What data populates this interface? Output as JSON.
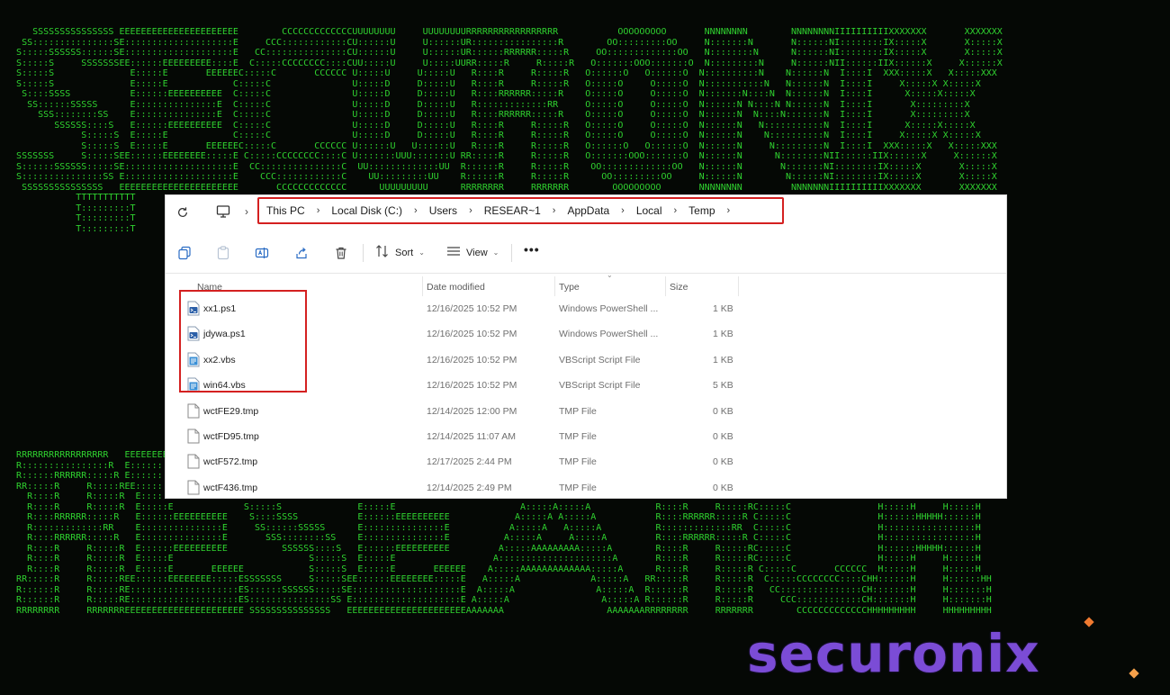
{
  "background": {
    "top_ascii": [
      "      SSSSSSSSSSSSSSS EEEEEEEEEEEEEEEEEEEEEE        CCCCCCCCCCCCCUUUUUUUU     UUUUUUUURRRRRRRRRRRRRRRRR           OOOOOOOOO       NNNNNNNN        NNNNNNNNIIIIIIIIIIXXXXXXX       XXXXXXX",
      "    SS:::::::::::::::SE::::::::::::::::::::E     CCC::::::::::::CU::::::U     U::::::UR::::::::::::::::R        OO:::::::::OO     N:::::::N       N::::::NI::::::::IX:::::X       X:::::X",
      "   S:::::SSSSSS::::::SE::::::::::::::::::::E   CC:::::::::::::::CU::::::U     U::::::UR::::::RRRRRR:::::R     OO:::::::::::::OO   N::::::::N      N::::::NI::::::::IX:::::X       X:::::X",
      "   S:::::S     SSSSSSSEE::::::EEEEEEEEE::::E  C:::::CCCCCCCC::::CUU:::::U     U:::::UURR:::::R     R:::::R   O:::::::OOO:::::::O  N:::::::::N     N::::::NII::::::IIX::::::X     X::::::X",
      "   S:::::S              E:::::E       EEEEEEC:::::C       CCCCCC U:::::U     U:::::U   R::::R     R:::::R   O::::::O   O::::::O  N::::::::::N    N::::::N  I::::I  XXX:::::X   X:::::XXX",
      "   S:::::S              E:::::E            C:::::C               U:::::D     D:::::U   R::::R     R:::::R   O:::::O     O:::::O  N:::::::::::N   N::::::N  I::::I     X:::::X X:::::X",
      "    S::::SSSS           E::::::EEEEEEEEEE  C:::::C               U:::::D     D:::::U   R::::RRRRRR:::::R    O:::::O     O:::::O  N:::::::N::::N  N::::::N  I::::I      X:::::X:::::X",
      "     SS::::::SSSSS      E:::::::::::::::E  C:::::C               U:::::D     D:::::U   R:::::::::::::RR     O:::::O     O:::::O  N::::::N N::::N N::::::N  I::::I       X:::::::::X",
      "       SSS::::::::SS    E:::::::::::::::E  C:::::C               U:::::D     D:::::U   R::::RRRRRR:::::R    O:::::O     O:::::O  N::::::N  N::::N:::::::N  I::::I       X:::::::::X",
      "          SSSSSS::::S   E::::::EEEEEEEEEE  C:::::C               U:::::D     D:::::U   R::::R     R:::::R   O:::::O     O:::::O  N::::::N   N:::::::::::N  I::::I      X:::::X:::::X",
      "               S:::::S  E:::::E            C:::::C               U:::::D     D:::::U   R::::R     R:::::R   O:::::O     O:::::O  N::::::N    N::::::::::N  I::::I     X:::::X X:::::X",
      "               S:::::S  E:::::E       EEEEEEC:::::C       CCCCCC U::::::U   U::::::U   R::::R     R:::::R   O::::::O   O::::::O  N::::::N     N:::::::::N  I::::I  XXX:::::X   X:::::XXX",
      "   SSSSSSS     S:::::SEE::::::EEEEEEEE:::::E C:::::CCCCCCCC::::C U:::::::UUU:::::::U RR:::::R     R:::::R   O:::::::OOO:::::::O  N::::::N      N::::::::NII::::::IIX::::::X     X::::::X",
      "   S::::::SSSSSS:::::SE::::::::::::::::::::E  CC:::::::::::::::C  UU:::::::::::::UU  R::::::R     R:::::R    OO:::::::::::::OO   N::::::N       N:::::::NI::::::::IX:::::X       X:::::X",
      "   S:::::::::::::::SS E::::::::::::::::::::E    CCC::::::::::::C    UU:::::::::UU    R::::::R     R:::::R      OO:::::::::OO     N::::::N        N::::::NI::::::::IX:::::X       X:::::X",
      "    SSSSSSSSSSSSSSS   EEEEEEEEEEEEEEEEEEEEEE       CCCCCCCCCCCCC      UUUUUUUUU      RRRRRRRR     RRRRRRR        OOOOOOOOO       NNNNNNNN         NNNNNNNIIIIIIIIIIXXXXXXX       XXXXXXX",
      "              TTTTTTTTTTT",
      "              T:::::::::T",
      "              T:::::::::T",
      "              T:::::::::T"
    ],
    "bottom_ascii": [
      "   RRRRRRRRRRRRRRRRR   EEEEEEEEEEEEEEEEEEEEEE   SSSSSSSSSSSSSSS EEEEEEEEEEEEEEEEEEEEEE               AAA               RRRRRRRRRRRRRRRRR           CCCCCCCCCCCCCHHHHHHHHH     HHHHHHHHH",
      "   R::::::::::::::::R  E::::::::::::::::::::E SS:::::::::::::::SE::::::::::::::::::::E              A:::A              R::::::::::::::::R       CCC::::::::::::CH:::::::H     H:::::::H",
      "   R::::::RRRRRR:::::R E::::::::::::::::::::ES:::::SSSSSS::::::SE::::::::::::::::::::E             A:::::A             R::::::RRRRRR:::::R    CC:::::::::::::::CH:::::::H     H:::::::H",
      "   RR:::::R     R:::::REE::::::EEEEEEEEE::::ES:::::S     SSSSSSSEE::::::EEEEEEEEE::::E            A:::::::A            RR:::::R     R:::::R  C:::::CCCCCCCC::::CHH::::::H     H::::::HH",
      "     R::::R     R:::::R  E:::::E       EEEEEES:::::S              E:::::E       EEEEEE           A:::::::::A             R::::R     R:::::R C:::::C       CCCCCC  H:::::H     H:::::H",
      "     R::::R     R:::::R  E:::::E             S:::::S              E:::::E                       A:::::A:::::A            R::::R     R:::::RC:::::C                H:::::H     H:::::H",
      "     R::::RRRRRR:::::R   E::::::EEEEEEEEEE    S::::SSSS           E::::::EEEEEEEEEE            A:::::A A:::::A           R::::RRRRRR:::::R C:::::C                H::::::HHHHH::::::H",
      "     R:::::::::::::RR    E:::::::::::::::E     SS::::::SSSSS      E:::::::::::::::E           A:::::A   A:::::A          R:::::::::::::RR  C:::::C                H:::::::::::::::::H",
      "     R::::RRRRRR:::::R   E:::::::::::::::E       SSS::::::::SS    E:::::::::::::::E          A:::::A     A:::::A         R::::RRRRRR:::::R C:::::C                H:::::::::::::::::H",
      "     R::::R     R:::::R  E::::::EEEEEEEEEE          SSSSSS::::S   E::::::EEEEEEEEEE         A:::::AAAAAAAAA:::::A        R::::R     R:::::RC:::::C                H::::::HHHHH::::::H",
      "     R::::R     R:::::R  E:::::E                         S:::::S  E:::::E                  A:::::::::::::::::::::A       R::::R     R:::::RC:::::C                H:::::H     H:::::H",
      "     R::::R     R:::::R  E:::::E       EEEEEE            S:::::S  E:::::E       EEEEEE    A:::::AAAAAAAAAAAAA:::::A      R::::R     R:::::R C:::::C       CCCCCC  H:::::H     H:::::H",
      "   RR:::::R     R:::::REE::::::EEEEEEEE:::::ESSSSSSS     S:::::SEE::::::EEEEEEEE:::::E   A:::::A             A:::::A   RR:::::R     R:::::R  C:::::CCCCCCCC::::CHH::::::H     H::::::HH",
      "   R::::::R     R:::::RE::::::::::::::::::::ES::::::SSSSSS:::::SE::::::::::::::::::::E  A:::::A               A:::::A  R::::::R     R:::::R   CC:::::::::::::::CH:::::::H     H:::::::H",
      "   R::::::R     R:::::RE::::::::::::::::::::ES:::::::::::::::SS E::::::::::::::::::::E A:::::A                 A:::::A R::::::R     R:::::R     CCC::::::::::::CH:::::::H     H:::::::H",
      "   RRRRRRRR     RRRRRRREEEEEEEEEEEEEEEEEEEEEE SSSSSSSSSSSSSSS   EEEEEEEEEEEEEEEEEEEEEEAAAAAAA                   AAAAAAARRRRRRRR     RRRRRRR        CCCCCCCCCCCCCHHHHHHHHH     HHHHHHHHH"
    ]
  },
  "explorer": {
    "breadcrumb": [
      "This PC",
      "Local Disk (C:)",
      "Users",
      "RESEAR~1",
      "AppData",
      "Local",
      "Temp"
    ],
    "toolbar": {
      "sort_label": "Sort",
      "view_label": "View",
      "more_label": "•••"
    },
    "columns": {
      "name": "Name",
      "date": "Date modified",
      "type": "Type",
      "size": "Size"
    },
    "files": [
      {
        "name": "xx1.ps1",
        "date": "12/16/2025 10:52 PM",
        "type": "Windows PowerShell ...",
        "size": "1 KB",
        "icon": "powershell-file-icon"
      },
      {
        "name": "jdywa.ps1",
        "date": "12/16/2025 10:52 PM",
        "type": "Windows PowerShell ...",
        "size": "1 KB",
        "icon": "powershell-file-icon"
      },
      {
        "name": "xx2.vbs",
        "date": "12/16/2025 10:52 PM",
        "type": "VBScript Script File",
        "size": "1 KB",
        "icon": "vbscript-file-icon"
      },
      {
        "name": "win64.vbs",
        "date": "12/16/2025 10:52 PM",
        "type": "VBScript Script File",
        "size": "5 KB",
        "icon": "vbscript-file-icon"
      },
      {
        "name": "wctFE29.tmp",
        "date": "12/14/2025 12:00 PM",
        "type": "TMP File",
        "size": "0 KB",
        "icon": "blank-file-icon"
      },
      {
        "name": "wctFD95.tmp",
        "date": "12/14/2025 11:07 AM",
        "type": "TMP File",
        "size": "0 KB",
        "icon": "blank-file-icon"
      },
      {
        "name": "wctF572.tmp",
        "date": "12/17/2025 2:44 PM",
        "type": "TMP File",
        "size": "0 KB",
        "icon": "blank-file-icon"
      },
      {
        "name": "wctF436.tmp",
        "date": "12/14/2025 2:49 PM",
        "type": "TMP File",
        "size": "0 KB",
        "icon": "blank-file-icon"
      }
    ]
  },
  "logo": {
    "text": "securonix",
    "color": "#7b4cd6",
    "accent": "#f07a30"
  },
  "colors": {
    "ascii_green": "#2fd12f",
    "highlight_red": "#d42020"
  }
}
